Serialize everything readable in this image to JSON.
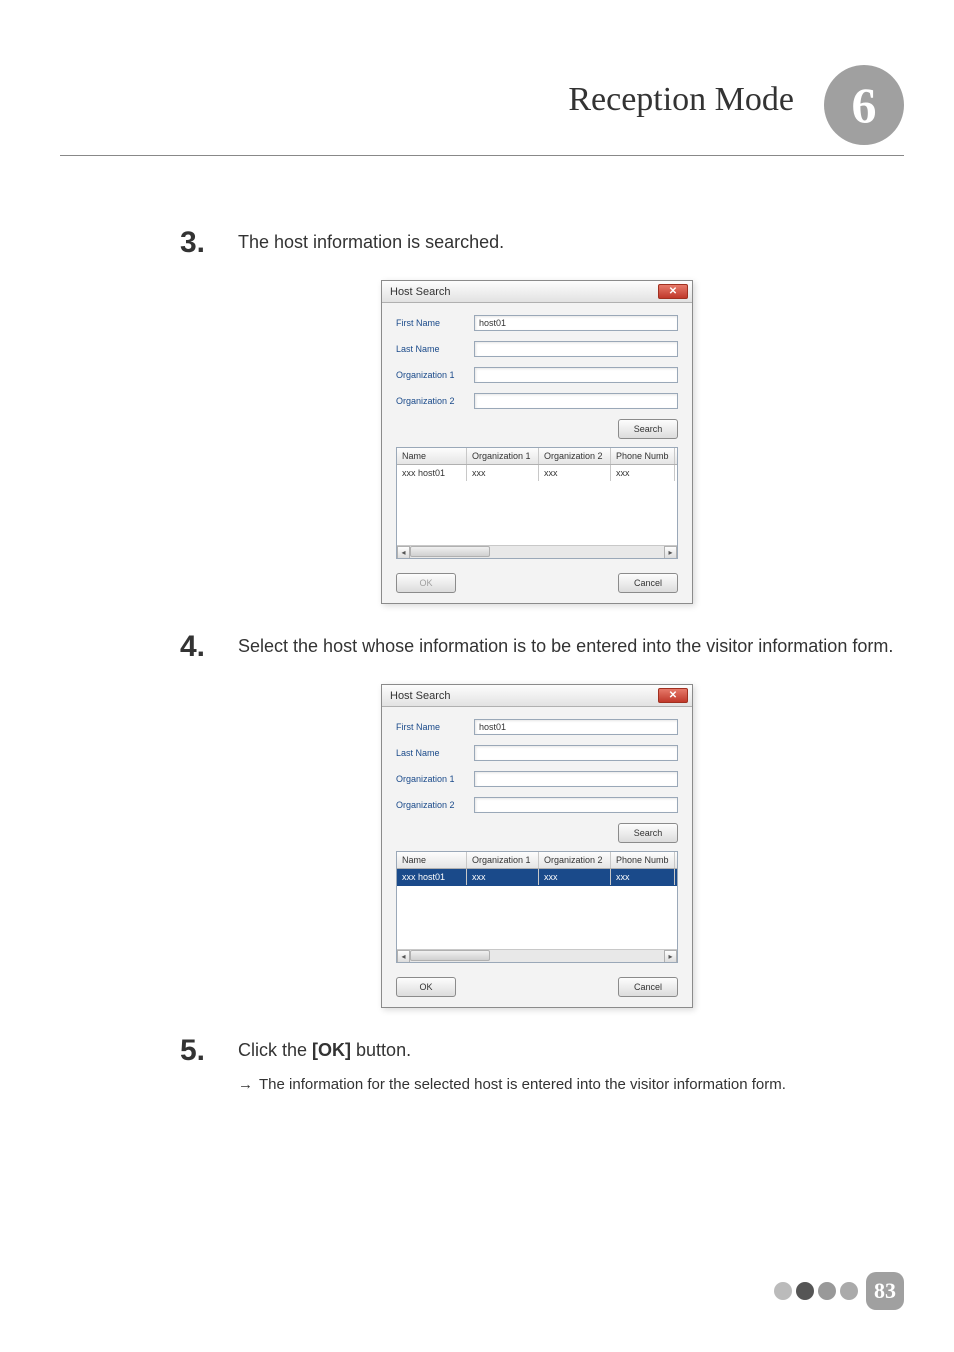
{
  "header": {
    "title": "Reception Mode",
    "chapter": "6"
  },
  "steps": {
    "s3": {
      "num": "3.",
      "text": "The host information is searched."
    },
    "s4": {
      "num": "4.",
      "text": "Select the host whose information is to be entered into the visitor information form."
    },
    "s5": {
      "num": "5.",
      "text_prefix": "Click the ",
      "bold": "[OK]",
      "text_suffix": " button.",
      "sub_arrow": "→",
      "sub": "The information for the selected host is entered into the visitor information form."
    }
  },
  "dialog": {
    "title": "Host Search",
    "close_glyph": "✕",
    "labels": {
      "first_name": "First Name",
      "last_name": "Last Name",
      "org1": "Organization 1",
      "org2": "Organization 2"
    },
    "values": {
      "first_name": "host01",
      "last_name": "",
      "org1": "",
      "org2": ""
    },
    "search_btn": "Search",
    "columns": {
      "name": "Name",
      "org1": "Organization 1",
      "org2": "Organization 2",
      "phone": "Phone Numb"
    },
    "row": {
      "name": "xxx host01",
      "org1": "xxx",
      "org2": "xxx",
      "phone": "xxx"
    },
    "scroll_left": "◂",
    "scroll_right": "▸",
    "ok_btn": "OK",
    "cancel_btn": "Cancel"
  },
  "footer": {
    "page": "83"
  }
}
